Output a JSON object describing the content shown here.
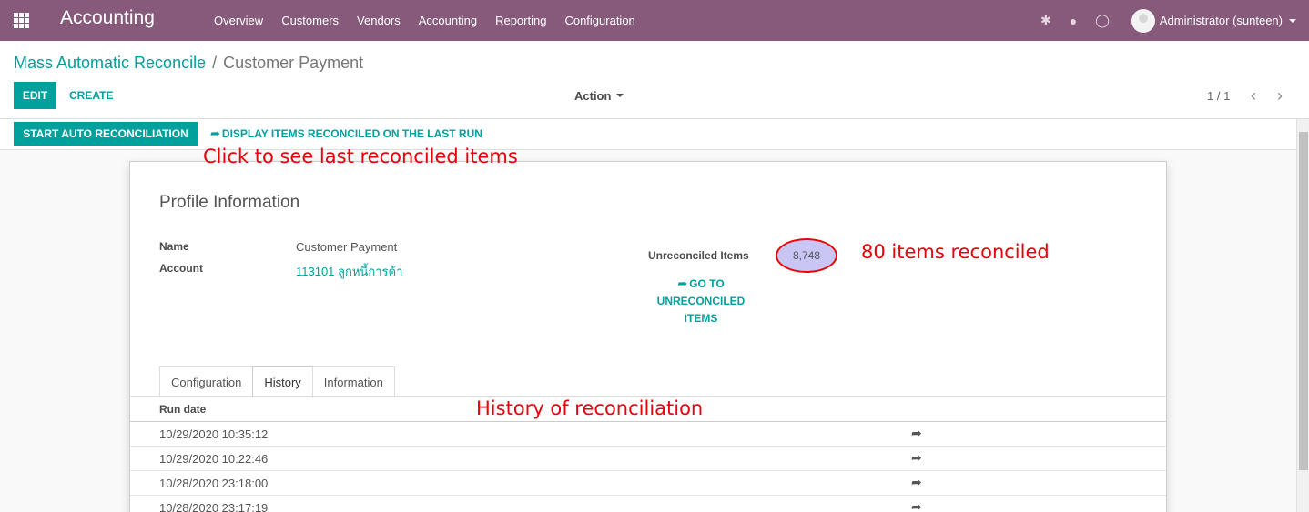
{
  "navbar": {
    "app_name": "Accounting",
    "menu": [
      "Overview",
      "Customers",
      "Vendors",
      "Accounting",
      "Reporting",
      "Configuration"
    ],
    "user_name": "Administrator (sunteen)",
    "bg_color": "#875a7b"
  },
  "control_panel": {
    "breadcrumb_parent": "Mass Automatic Reconcile",
    "breadcrumb_sep": "/",
    "breadcrumb_current": "Customer Payment",
    "edit_label": "EDIT",
    "create_label": "CREATE",
    "action_label": "Action",
    "pager": "1 / 1"
  },
  "statusbar": {
    "start_label": "START AUTO RECONCILIATION",
    "display_label": "DISPLAY ITEMS RECONCILED ON THE LAST RUN"
  },
  "form": {
    "title": "Profile Information",
    "name_label": "Name",
    "name_value": "Customer Payment",
    "account_label": "Account",
    "account_value": "113101 ลูกหนี้การค้า",
    "unreconciled_label": "Unreconciled Items",
    "unreconciled_count": "8,748",
    "goto_line1": "GO TO",
    "goto_line2": "UNRECONCILED",
    "goto_line3": "ITEMS"
  },
  "tabs": [
    "Configuration",
    "History",
    "Information"
  ],
  "history": {
    "column": "Run date",
    "rows": [
      "10/29/2020 10:35:12",
      "10/29/2020 10:22:46",
      "10/28/2020 23:18:00",
      "10/28/2020 23:17:19"
    ]
  },
  "annotations": {
    "last_items": "Click to see last reconciled items",
    "reconciled": "80 items reconciled",
    "history": "History of reconciliation"
  },
  "colors": {
    "accent": "#00a09d",
    "annotation": "#e8000b"
  }
}
